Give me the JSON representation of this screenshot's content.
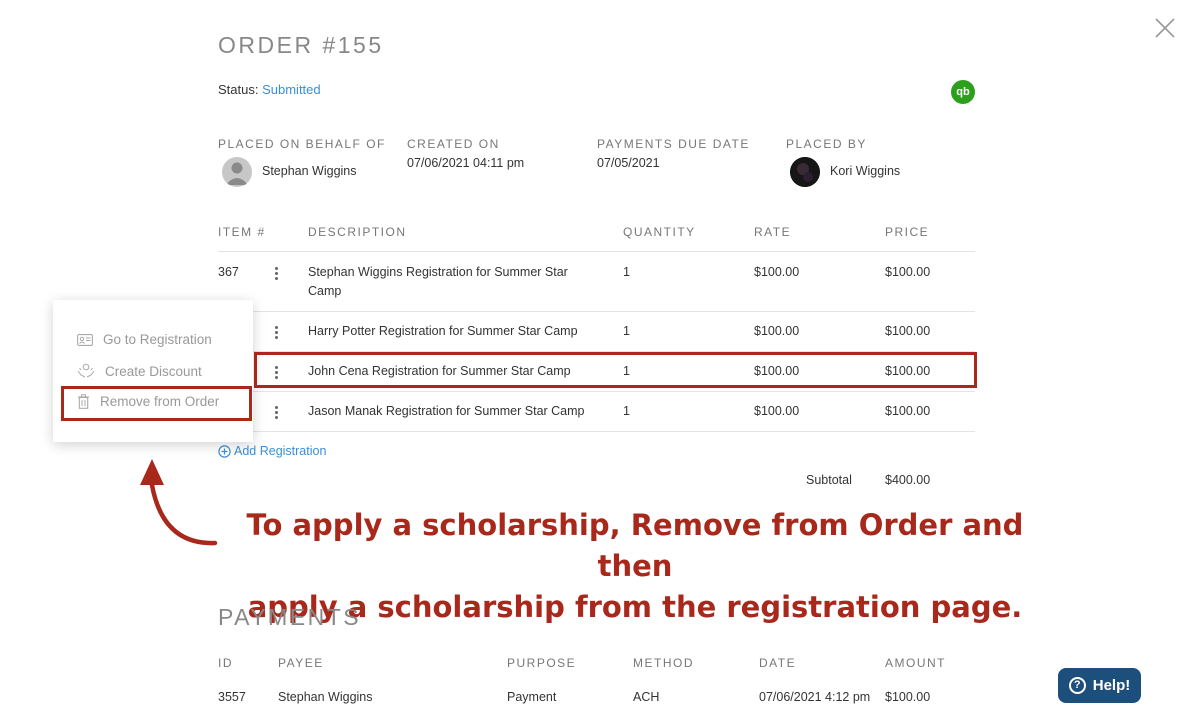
{
  "order": {
    "title": "ORDER #155",
    "status_label": "Status:",
    "status_value": "Submitted",
    "qb_icon_text": "qb"
  },
  "meta": {
    "placed_on_behalf_label": "PLACED ON BEHALF OF",
    "placed_on_behalf_value": "Stephan Wiggins",
    "created_on_label": "CREATED ON",
    "created_on_value": "07/06/2021 04:11 pm",
    "payments_due_label": "PAYMENTS DUE DATE",
    "payments_due_value": "07/05/2021",
    "placed_by_label": "PLACED BY",
    "placed_by_value": "Kori Wiggins"
  },
  "items_table": {
    "headers": [
      "ITEM #",
      "DESCRIPTION",
      "QUANTITY",
      "RATE",
      "PRICE"
    ],
    "rows": [
      {
        "item": "367",
        "description": "Stephan Wiggins Registration for Summer Star Camp",
        "quantity": "1",
        "rate": "$100.00",
        "price": "$100.00"
      },
      {
        "item": "",
        "description": "Harry Potter Registration for Summer Star Camp",
        "quantity": "1",
        "rate": "$100.00",
        "price": "$100.00"
      },
      {
        "item": "",
        "description": "John Cena Registration for Summer Star Camp",
        "quantity": "1",
        "rate": "$100.00",
        "price": "$100.00"
      },
      {
        "item": "",
        "description": "Jason Manak Registration for Summer Star Camp",
        "quantity": "1",
        "rate": "$100.00",
        "price": "$100.00"
      }
    ],
    "add_registration": "Add Registration",
    "subtotal_label": "Subtotal",
    "subtotal_value": "$400.00"
  },
  "context_menu": {
    "items": [
      "Go to Registration",
      "Create Discount",
      "Remove from Order"
    ]
  },
  "annotation": {
    "line1": "To apply a scholarship, Remove from Order and then",
    "line2": "apply a scholarship from the registration page."
  },
  "payments": {
    "title": "PAYMENTS",
    "headers": [
      "ID",
      "PAYEE",
      "PURPOSE",
      "METHOD",
      "DATE",
      "AMOUNT"
    ],
    "rows": [
      {
        "id": "3557",
        "payee": "Stephan Wiggins",
        "purpose": "Payment",
        "method": "ACH",
        "date": "07/06/2021 4:12 pm",
        "amount": "$100.00"
      }
    ]
  },
  "help": {
    "label": "Help!",
    "icon_text": "?"
  },
  "colors": {
    "accent_link": "#3b8fd6",
    "annotation_red": "#a8291b",
    "help_bg": "#1d4f7c",
    "qb_green": "#2ca01c"
  }
}
